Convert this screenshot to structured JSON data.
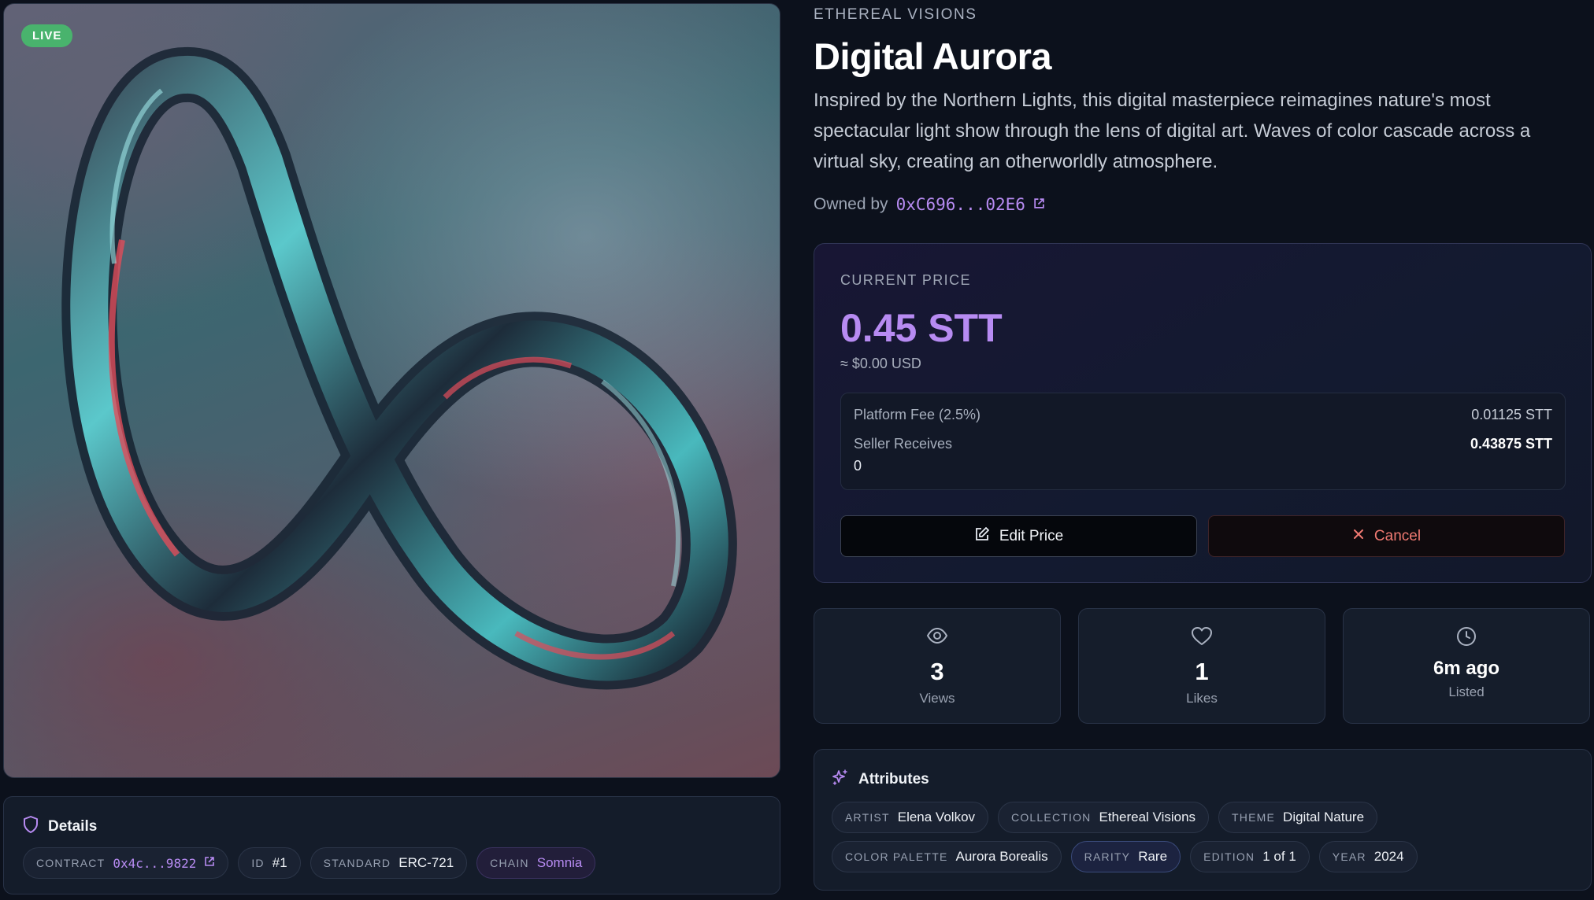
{
  "artwork": {
    "badge": "LIVE",
    "colors": {
      "badge": "#49b36d"
    }
  },
  "details": {
    "title": "Details",
    "chips": [
      {
        "key": "CONTRACT",
        "value": "0x4c...9822"
      },
      {
        "key": "ID",
        "value": "#1"
      },
      {
        "key": "STANDARD",
        "value": "ERC-721"
      },
      {
        "key": "CHAIN",
        "value": "Somnia"
      }
    ]
  },
  "nft": {
    "collection": "ETHEREAL VISIONS",
    "title": "Digital Aurora",
    "description": "Inspired by the Northern Lights, this digital masterpiece reimagines nature's most spectacular light show through the lens of digital art. Waves of color cascade across a virtual sky, creating an otherworldly atmosphere.",
    "owner_label": "Owned by",
    "owner_address": "0xC696...02E6"
  },
  "price": {
    "label": "CURRENT PRICE",
    "value": "0.45 STT",
    "usd": "≈ $0.00 USD",
    "fee_label": "Platform Fee (2.5%)",
    "fee_value": "0.01125 STT",
    "seller_label": "Seller Receives",
    "seller_value": "0.43875 STT",
    "extra_value": "0",
    "edit_label": "Edit Price",
    "cancel_label": "Cancel",
    "colors": {
      "accent": "#b78bf2",
      "cancel": "#f07a72"
    }
  },
  "stats": [
    {
      "icon": "eye-icon",
      "value": "3",
      "label": "Views"
    },
    {
      "icon": "heart-icon",
      "value": "1",
      "label": "Likes"
    },
    {
      "icon": "clock-icon",
      "value": "6m ago",
      "label": "Listed"
    }
  ],
  "attributes": {
    "title": "Attributes",
    "items": [
      {
        "key": "ARTIST",
        "value": "Elena Volkov"
      },
      {
        "key": "COLLECTION",
        "value": "Ethereal Visions"
      },
      {
        "key": "THEME",
        "value": "Digital Nature"
      },
      {
        "key": "COLOR PALETTE",
        "value": "Aurora Borealis"
      },
      {
        "key": "RARITY",
        "value": "Rare"
      },
      {
        "key": "EDITION",
        "value": "1 of 1"
      },
      {
        "key": "YEAR",
        "value": "2024"
      }
    ]
  }
}
